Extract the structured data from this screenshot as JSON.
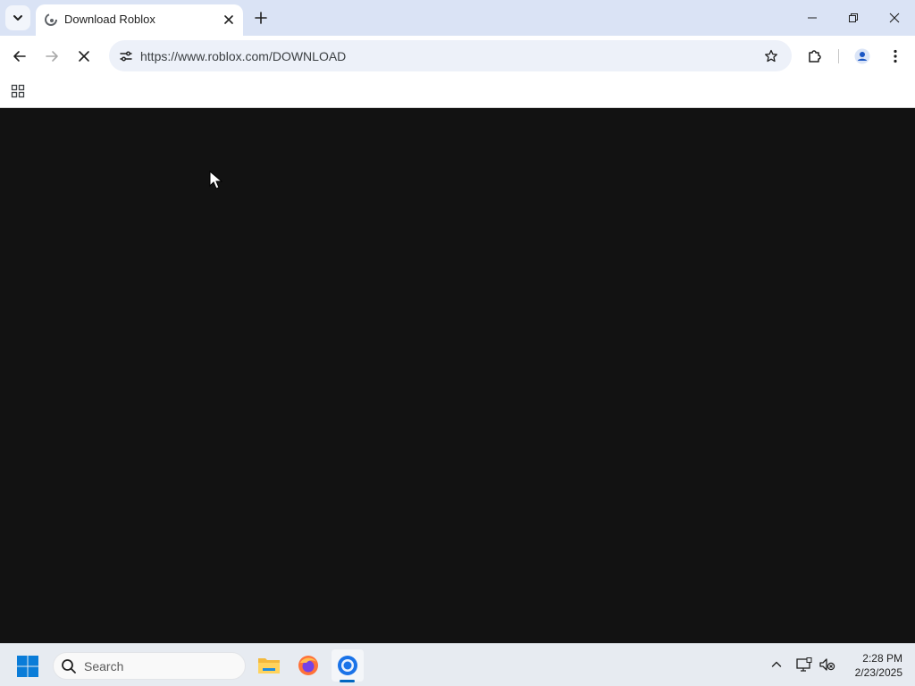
{
  "browser": {
    "active_tab": {
      "title": "Download Roblox",
      "favicon": "roblox-loading-icon"
    },
    "address_bar": {
      "url": "https://www.roblox.com/DOWNLOAD"
    },
    "icons": {
      "tab_search": "chevron-down-icon",
      "close_tab": "close-icon",
      "new_tab": "plus-icon",
      "back": "arrow-left-icon",
      "forward": "arrow-right-icon",
      "stop": "close-icon",
      "site_info": "tune-icon",
      "bookmark": "star-icon",
      "extensions": "puzzle-icon",
      "profile": "person-icon",
      "menu": "kebab-menu-icon",
      "apps": "grid-icon"
    },
    "colors": {
      "titlebar": "#dae3f5",
      "omnibox": "#edf1f9",
      "page_background": "#121212"
    }
  },
  "taskbar": {
    "search": {
      "label": "Search"
    },
    "apps": [
      {
        "name": "File Explorer",
        "icon": "folder-icon"
      },
      {
        "name": "Firefox",
        "icon": "firefox-icon"
      },
      {
        "name": "Chrome",
        "icon": "chrome-icon",
        "active": true
      }
    ],
    "clock": {
      "time": "2:28 PM",
      "date": "2/23/2025"
    }
  }
}
